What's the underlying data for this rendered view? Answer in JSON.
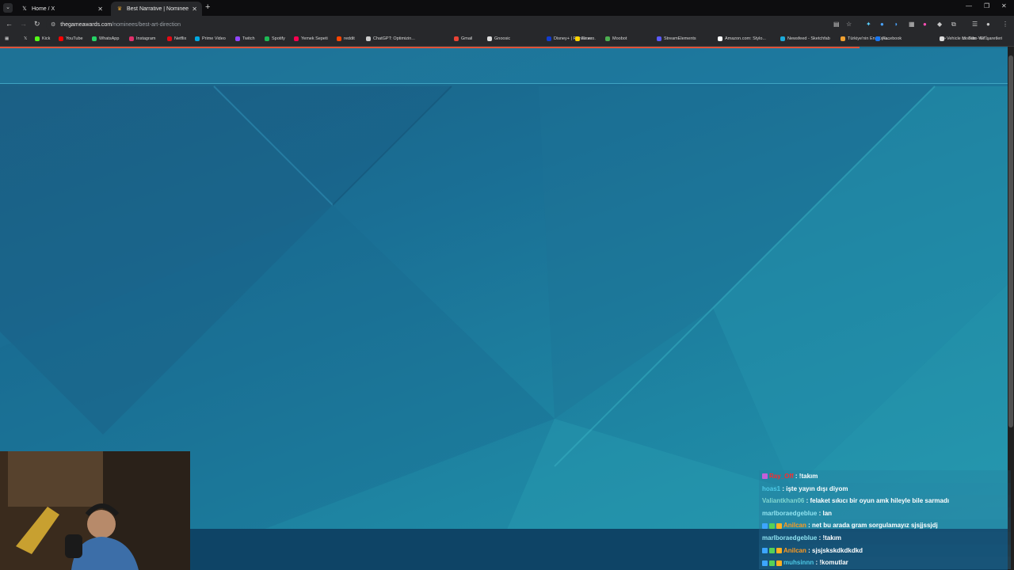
{
  "tabs": [
    {
      "label": "Home / X",
      "icon": "x-icon",
      "active": false
    },
    {
      "label": "Best Narrative | Nominees | The",
      "icon": "tga-icon",
      "active": true
    }
  ],
  "url": {
    "host": "thegameawards.com",
    "path": "/nominees/best-art-direction"
  },
  "bookmarks": [
    {
      "label": "Kick",
      "color": "#53fc18"
    },
    {
      "label": "YouTube",
      "color": "#ff0000"
    },
    {
      "label": "WhatsApp",
      "color": "#25d366"
    },
    {
      "label": "Instagram",
      "color": "#e1306c"
    },
    {
      "label": "Netflix",
      "color": "#e50914"
    },
    {
      "label": "Prime Video",
      "color": "#00a8e1"
    },
    {
      "label": "Twitch",
      "color": "#9146ff"
    },
    {
      "label": "Spotify",
      "color": "#1db954"
    },
    {
      "label": "Yemek Sepeti",
      "color": "#fa0050"
    },
    {
      "label": "reddit",
      "color": "#ff4500"
    },
    {
      "label": "ChatGPT: Optimizin...",
      "color": "#cccccc"
    },
    {
      "label": "Gmail",
      "color": "#ea4335"
    },
    {
      "label": "Gnoosic",
      "color": "#dddddd"
    },
    {
      "label": "Disney+ | Filmler ve...",
      "color": "#113ccf"
    },
    {
      "label": "Exxen",
      "color": "#ffd400"
    },
    {
      "label": "Moobot",
      "color": "#4caf50"
    },
    {
      "label": "StreamElements",
      "color": "#5a5aff"
    },
    {
      "label": "Amazon.com: Stylo...",
      "color": "#ffffff"
    },
    {
      "label": "Newsfeed - Sketchfab",
      "color": "#1caad9"
    },
    {
      "label": "Türkiye'nin En Büyü...",
      "color": "#f0a030"
    },
    {
      "label": "Facebook",
      "color": "#1877f2"
    },
    {
      "label": "Vehicle Models - GT...",
      "color": "#dddddd"
    }
  ],
  "bookmarks_more": "»",
  "all_bookmarks": "Tüm Yer İşaretleri",
  "chat": [
    {
      "user": "Ray_Off",
      "message": "!takım",
      "user_color": "#ff2a2a",
      "badges": [
        "#c45fd9"
      ]
    },
    {
      "user": "hoas1",
      "message": "işte yayın dışı diyom",
      "user_color": "#4ec9e6",
      "badges": []
    },
    {
      "user": "Valiantkhan06",
      "message": "felaket sıkıcı bir oyun amk hileyle bile sarmadı",
      "user_color": "#7fd6d0",
      "badges": []
    },
    {
      "user": "marlboraedgeblue",
      "message": "lan",
      "user_color": "#8fe3f0",
      "badges": []
    },
    {
      "user": "Anilcan",
      "message": "net bu arada gram sorgulamayız sjsjjssjdj",
      "user_color": "#ff9a1f",
      "badges": [
        "#3da5ff",
        "#56d156",
        "#ffb020"
      ]
    },
    {
      "user": "marlboraedgeblue",
      "message": "!takım",
      "user_color": "#8fe3f0",
      "badges": []
    },
    {
      "user": "Anilcan",
      "message": "sjsjskskdkdkdkd",
      "user_color": "#ff9a1f",
      "badges": [
        "#3da5ff",
        "#56d156",
        "#ffb020"
      ]
    },
    {
      "user": "muhsinnn",
      "message": "!komutlar",
      "user_color": "#4ec9e6",
      "badges": [
        "#3da5ff",
        "#56d156",
        "#ffb020"
      ]
    }
  ]
}
